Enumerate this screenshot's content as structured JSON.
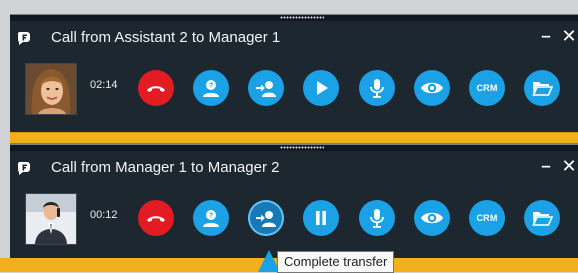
{
  "colors": {
    "panel_bg": "#1d2730",
    "accent_blue": "#1aa1e6",
    "hangup_red": "#e31b23",
    "separator_yellow": "#f2b01a"
  },
  "calls": [
    {
      "title": "Call from Assistant 2 to Manager 1",
      "timer": "02:14",
      "avatar": "person-photo-woman",
      "play_state": "play-icon"
    },
    {
      "title": "Call from Manager 1 to Manager 2",
      "timer": "00:12",
      "avatar": "person-photo-man",
      "play_state": "pause-icon"
    }
  ],
  "buttons": {
    "crm_label": "CRM"
  },
  "window": {
    "minimize": "–",
    "close": "✕"
  },
  "tooltip": {
    "text": "Complete transfer"
  }
}
